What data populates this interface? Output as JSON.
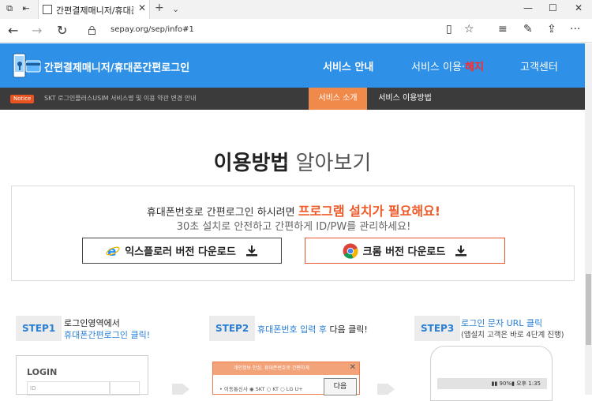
{
  "browser": {
    "tab_title": "간편결제매니저/휴대폰",
    "url": "sepay.org/sep/info#1"
  },
  "site": {
    "brand": "간편결제매니저/휴대폰간편로그인",
    "nav": [
      {
        "label": "서비스 안내",
        "active": true
      },
      {
        "label": "서비스 이용·",
        "highlight": "해지"
      },
      {
        "label": "고객센터"
      }
    ],
    "notice_badge": "Notice",
    "notice_text": "SKT 로그인플러스USIM 서비스명 및 이용 약관 변경 안내",
    "subtabs": [
      "서비스 소개",
      "서비스 이용방법"
    ],
    "colors": {
      "header": "#2e90e6",
      "accent": "#f08a4b",
      "highlight": "#ff2a2a"
    }
  },
  "main": {
    "title_bold": "이용방법",
    "title_light": "알아보기",
    "info_line1_prefix": "휴대폰번호로 간편로그인 하시려면",
    "info_line1_highlight": "프로그램 설치가 필요해요!",
    "info_line2": "30초 설치로 안전하고 간편하게 ID/PW를 관리하세요!",
    "ie_download": "익스플로러 버전 다운로드",
    "chrome_download": "크롬 버전 다운로드"
  },
  "steps": [
    {
      "badge": "STEP1",
      "line1": "로그인영역에서",
      "line2": "휴대폰간편로그인 클릭!"
    },
    {
      "badge": "STEP2",
      "line1_blue": "휴대폰번호 입력 후",
      "line1_rest": " 다음 클릭!"
    },
    {
      "badge": "STEP3",
      "line1": "로그인 문자 URL 클릭",
      "line2": "(앱설치 고객은 바로 4단계 진행)"
    }
  ],
  "mock": {
    "login_title": "LOGIN",
    "login_id": "ID",
    "popup_head": "개인정보 안심, 휴대폰번호로 간편하게",
    "popup_row": "• 이동통신사  ◉ SKT  ○ KT  ○ LG U+",
    "popup_next": "다음",
    "phone_status": "▮▮ 90%▮ 오후 1:35"
  }
}
